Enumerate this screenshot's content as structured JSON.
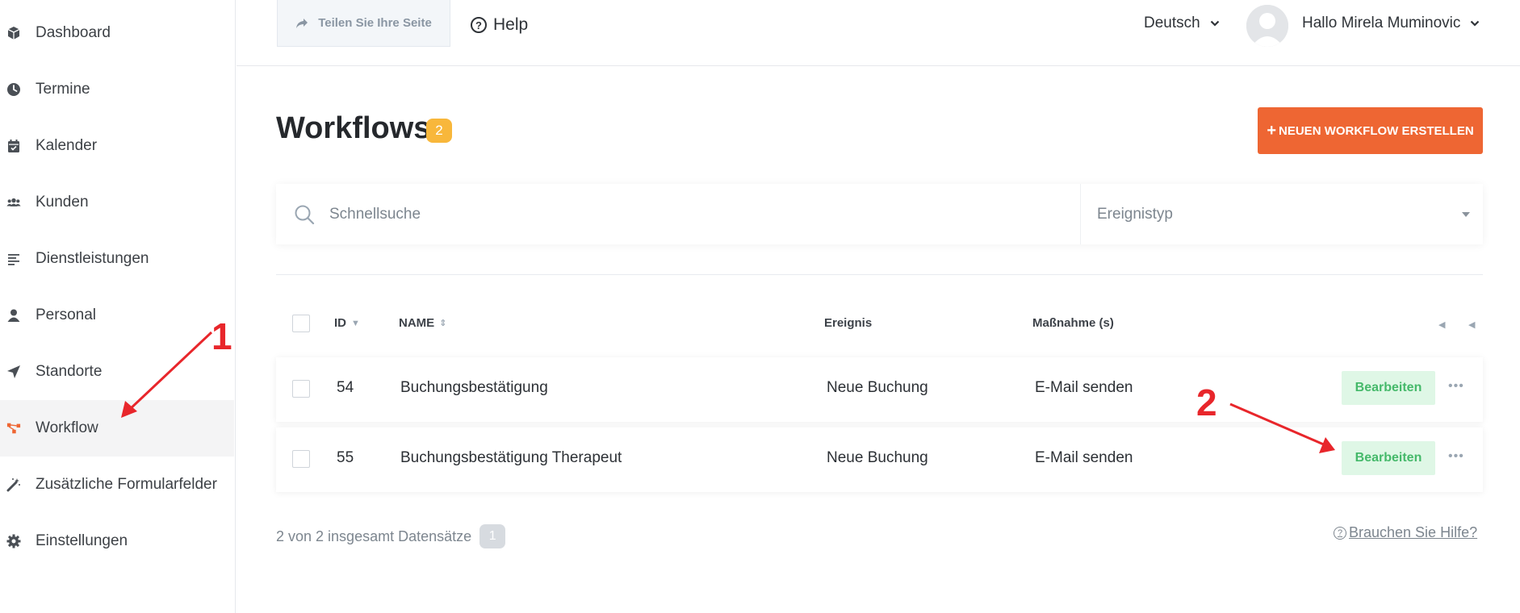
{
  "sidebar": {
    "items": [
      {
        "label": "Dashboard",
        "icon": "cube-icon"
      },
      {
        "label": "Termine",
        "icon": "clock-icon"
      },
      {
        "label": "Kalender",
        "icon": "calendar-icon"
      },
      {
        "label": "Kunden",
        "icon": "users-icon"
      },
      {
        "label": "Dienstleistungen",
        "icon": "list-icon"
      },
      {
        "label": "Personal",
        "icon": "user-icon"
      },
      {
        "label": "Standorte",
        "icon": "location-arrow-icon"
      },
      {
        "label": "Workflow",
        "icon": "workflow-icon",
        "active": true
      },
      {
        "label": "Zusätzliche Formularfelder",
        "icon": "magic-wand-icon"
      },
      {
        "label": "Einstellungen",
        "icon": "gear-icon"
      }
    ]
  },
  "topbar": {
    "share_label": "Teilen Sie Ihre Seite",
    "help_label": "Help",
    "language": "Deutsch",
    "user_greeting": "Hallo Mirela Muminovic"
  },
  "main": {
    "title": "Workflows",
    "count": "2",
    "create_button": "NEUEN WORKFLOW ERSTELLEN",
    "search_placeholder": "Schnellsuche",
    "event_type_placeholder": "Ereignistyp",
    "columns": {
      "id": "ID",
      "name": "NAME",
      "event": "Ereignis",
      "action": "Maßnahme (s)"
    },
    "rows": [
      {
        "id": "54",
        "name": "Buchungsbestätigung",
        "event": "Neue Buchung",
        "action": "E-Mail senden",
        "edit": "Bearbeiten",
        "more": "•••"
      },
      {
        "id": "55",
        "name": "Buchungsbestätigung Therapeut",
        "event": "Neue Buchung",
        "action": "E-Mail senden",
        "edit": "Bearbeiten",
        "more": "•••"
      }
    ],
    "records_text": "2 von 2 insgesamt Datensätze",
    "page": "1",
    "help_link": "Brauchen Sie Hilfe?"
  },
  "annotations": {
    "label_1": "1",
    "label_2": "2"
  },
  "colors": {
    "accent": "#ee6633",
    "badge": "#f8b73b",
    "edit_bg": "#dff7e6",
    "edit_text": "#45b96a",
    "annotation": "#e8262b"
  }
}
